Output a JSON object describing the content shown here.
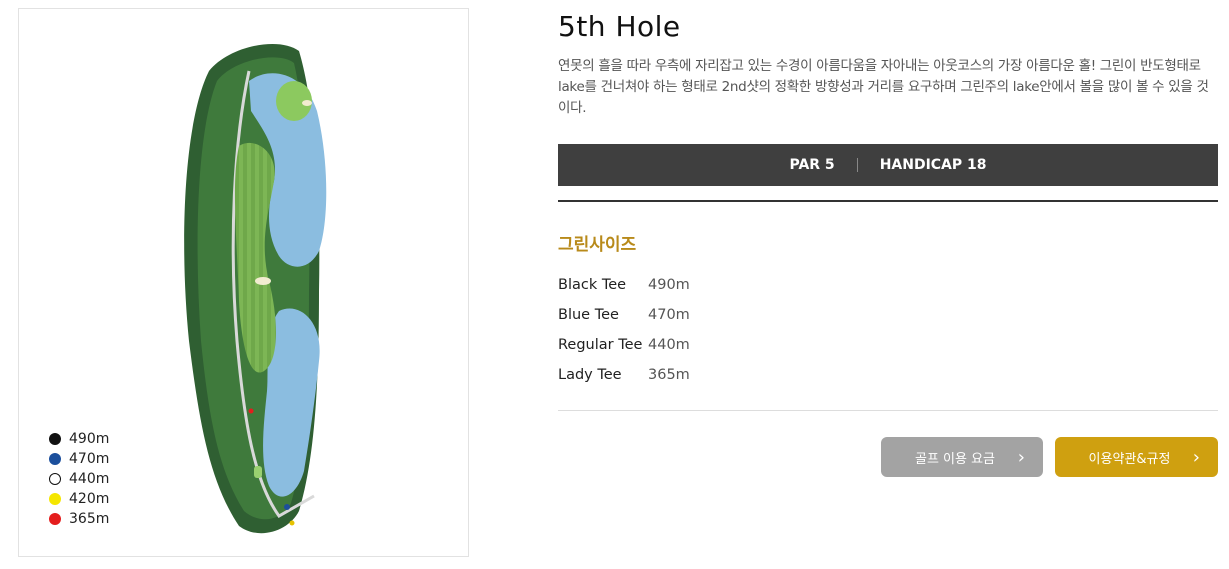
{
  "map": {
    "legend": [
      {
        "label": "490m",
        "color": "#111111"
      },
      {
        "label": "470m",
        "color": "#1c4f9c"
      },
      {
        "label": "440m",
        "color": "#ffffff"
      },
      {
        "label": "420m",
        "color": "#f5e600"
      },
      {
        "label": "365m",
        "color": "#e41d1d"
      }
    ]
  },
  "hole": {
    "title": "5th Hole",
    "description": "연못의 흘을 따라 우측에 자리잡고 있는 수경이 아름다움을 자아내는 아웃코스의 가장 아름다운 홀! 그린이 반도형태로 lake를 건너쳐야 하는 형태로 2nd샷의 정확한 방향성과 거리를 요구하며 그린주의 lake안에서 볼을 많이 볼 수 있을 것이다."
  },
  "info_bar": {
    "par": "PAR 5",
    "handicap": "HANDICAP 18"
  },
  "green_size": {
    "title": "그린사이즈",
    "tees": [
      {
        "name": "Black Tee",
        "distance": "490m"
      },
      {
        "name": "Blue Tee",
        "distance": "470m"
      },
      {
        "name": "Regular Tee",
        "distance": "440m"
      },
      {
        "name": "Lady Tee",
        "distance": "365m"
      }
    ]
  },
  "buttons": {
    "fee": "골프 이용 요금",
    "terms": "이용약관&규정",
    "chevron": "›"
  },
  "colors": {
    "dark_bar": "#3f3f3f",
    "accent": "#cfa010",
    "section_title": "#b88a1a",
    "gray_button": "#a3a3a3"
  }
}
